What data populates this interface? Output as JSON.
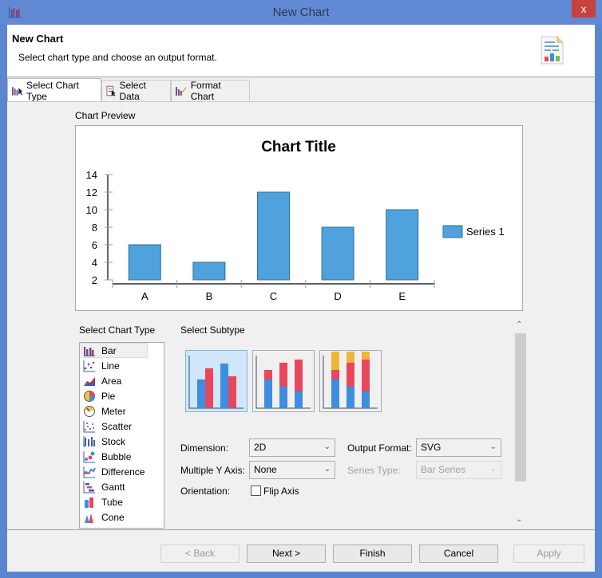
{
  "window": {
    "title": "New Chart",
    "close_label": "x"
  },
  "header": {
    "title": "New Chart",
    "description": "Select chart type and choose an output format."
  },
  "tabs": [
    {
      "label": "Select Chart Type",
      "icon": "chart-type-icon",
      "active": true
    },
    {
      "label": "Select Data",
      "icon": "data-sheet-icon",
      "active": false
    },
    {
      "label": "Format Chart",
      "icon": "format-chart-icon",
      "active": false
    }
  ],
  "preview": {
    "label": "Chart Preview"
  },
  "chart_data": {
    "type": "bar",
    "title": "Chart Title",
    "categories": [
      "A",
      "B",
      "C",
      "D",
      "E"
    ],
    "series": [
      {
        "name": "Series 1",
        "values": [
          6,
          4,
          12,
          8,
          10
        ],
        "color": "#4fa2dc"
      }
    ],
    "xlabel": "",
    "ylabel": "",
    "ylim": [
      2,
      14
    ],
    "yticks": [
      2,
      4,
      6,
      8,
      10,
      12,
      14
    ],
    "grid": false,
    "legend": "right"
  },
  "chart_type_section": {
    "label": "Select Chart Type",
    "items": [
      "Bar",
      "Line",
      "Area",
      "Pie",
      "Meter",
      "Scatter",
      "Stock",
      "Bubble",
      "Difference",
      "Gantt",
      "Tube",
      "Cone"
    ],
    "selected": "Bar"
  },
  "subtype_section": {
    "label": "Select Subtype",
    "subtypes": [
      "side-by-side",
      "stacked",
      "percent-stacked"
    ],
    "selected": "side-by-side"
  },
  "options": {
    "dimension_label": "Dimension:",
    "dimension_value": "2D",
    "output_format_label": "Output Format:",
    "output_format_value": "SVG",
    "multiple_y_label": "Multiple Y Axis:",
    "multiple_y_value": "None",
    "series_type_label": "Series Type:",
    "series_type_value": "Bar Series",
    "orientation_label": "Orientation:",
    "flip_axis_label": "Flip Axis",
    "flip_axis_checked": false
  },
  "buttons": {
    "back": "< Back",
    "next": "Next >",
    "finish": "Finish",
    "cancel": "Cancel",
    "apply": "Apply"
  },
  "colors": {
    "titlebar": "#6289d3",
    "close": "#c7423d",
    "bar": "#4fa2dc",
    "bar_red": "#e8475b",
    "bar_gold": "#f2b53a"
  }
}
